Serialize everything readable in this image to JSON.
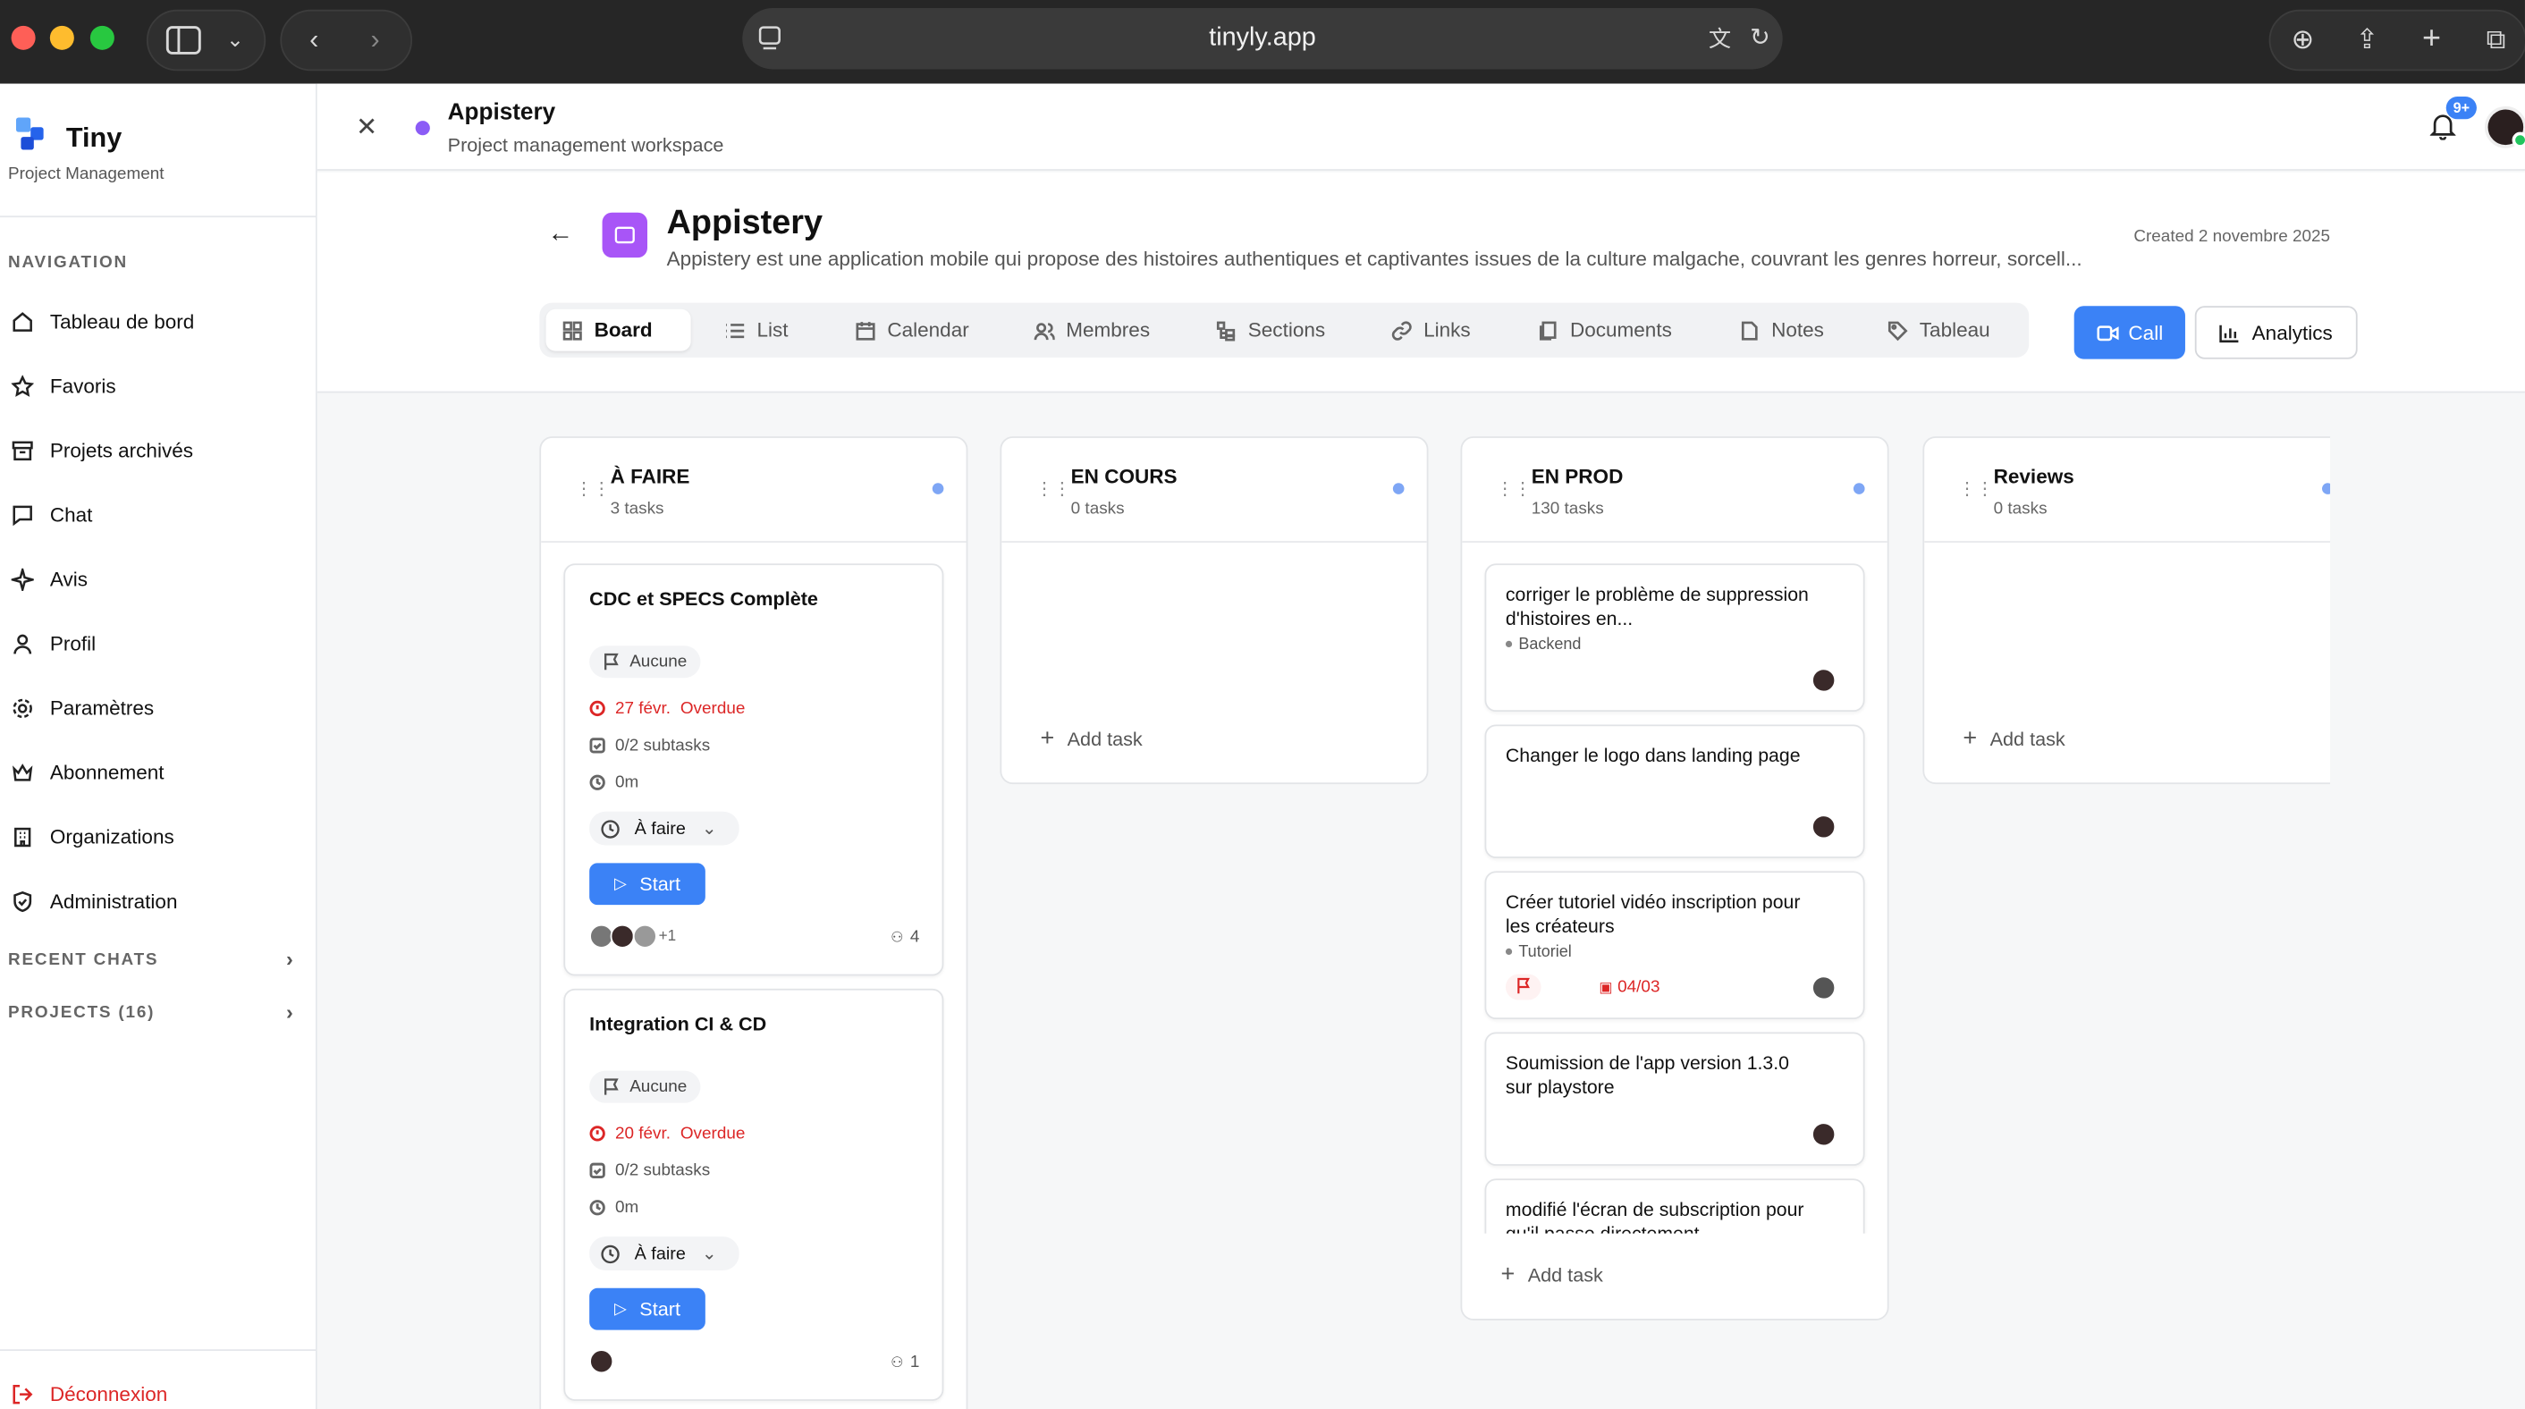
{
  "browser": {
    "url": "tinyly.app"
  },
  "sidebar": {
    "brand": "Tiny",
    "brand_sub": "Project Management",
    "nav_label": "NAVIGATION",
    "items": [
      "Tableau de bord",
      "Favoris",
      "Projets archivés",
      "Chat",
      "Avis",
      "Profil",
      "Paramètres",
      "Abonnement",
      "Organizations",
      "Administration"
    ],
    "recent_chats": "RECENT CHATS",
    "projects": "PROJECTS (16)",
    "logout": "Déconnexion"
  },
  "topbar": {
    "title": "Appistery",
    "subtitle": "Project management workspace",
    "notif_badge": "9+"
  },
  "project": {
    "title": "Appistery",
    "description": "Appistery est une application mobile qui propose des histoires authentiques et captivantes issues de la culture malgache, couvrant les genres horreur, sorcell...",
    "created": "Created 2 novembre 2025"
  },
  "tabs": [
    "Board",
    "List",
    "Calendar",
    "Membres",
    "Sections",
    "Links",
    "Documents",
    "Notes",
    "Tableau"
  ],
  "actions": {
    "call": "Call",
    "analytics": "Analytics"
  },
  "columns": [
    {
      "title": "À FAIRE",
      "count": "3 tasks"
    },
    {
      "title": "EN COURS",
      "count": "0 tasks",
      "add": "Add task"
    },
    {
      "title": "EN PROD",
      "count": "130 tasks",
      "add": "Add task"
    },
    {
      "title": "Reviews",
      "count": "0 tasks",
      "add": "Add task"
    }
  ],
  "todo_cards": [
    {
      "title": "CDC et SPECS Complète",
      "priority": "Aucune",
      "date": "27 févr.",
      "overdue": "Overdue",
      "subtasks": "0/2 subtasks",
      "time": "0m",
      "status": "À faire",
      "start": "Start",
      "extra": "+1",
      "assignees": "4"
    },
    {
      "title": "Integration CI & CD",
      "priority": "Aucune",
      "date": "20 févr.",
      "overdue": "Overdue",
      "subtasks": "0/2 subtasks",
      "time": "0m",
      "status": "À faire",
      "start": "Start",
      "assignees": "1"
    }
  ],
  "prod_cards": [
    {
      "title": "corriger le problème de suppression d'histoires en...",
      "tag": "Backend"
    },
    {
      "title": "Changer le logo dans landing page"
    },
    {
      "title": "Créer tutoriel vidéo inscription pour les créateurs",
      "tag": "Tutoriel",
      "date": "04/03"
    },
    {
      "title": "Soumission de l'app version 1.3.0 sur playstore"
    },
    {
      "title": "modifié l'écran de subscription pour qu'il passe directement..."
    }
  ],
  "colors": {
    "accent": "#3b82f6",
    "overdue": "#dc2626",
    "project_icon": "#a855f7"
  }
}
